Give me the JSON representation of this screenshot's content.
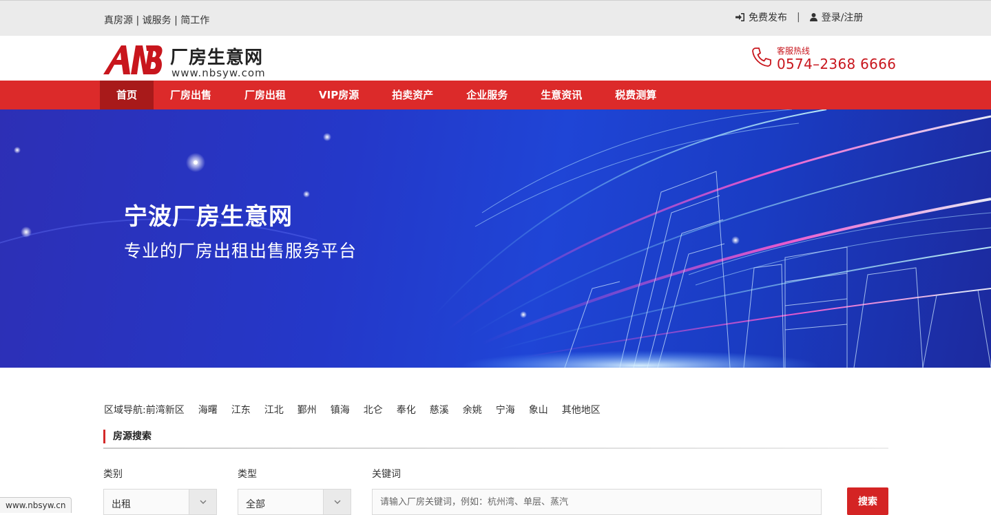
{
  "topbar": {
    "slogan": "真房源 | 诚服务 | 简工作",
    "publish": "免费发布",
    "separator": "|",
    "login": "登录/注册"
  },
  "header": {
    "logo_mark": "NB",
    "logo_name": "厂房生意网",
    "logo_url": "www.nbsyw.com",
    "hotline_label": "客服热线",
    "hotline_number": "0574–2368 6666"
  },
  "nav": {
    "items": [
      {
        "label": "首页"
      },
      {
        "label": "厂房出售"
      },
      {
        "label": "厂房出租"
      },
      {
        "label": "VIP房源"
      },
      {
        "label": "拍卖资产"
      },
      {
        "label": "企业服务"
      },
      {
        "label": "生意资讯"
      },
      {
        "label": "税费测算"
      }
    ]
  },
  "banner": {
    "title": "宁波厂房生意网",
    "subtitle": "专业的厂房出租出售服务平台"
  },
  "area_nav": {
    "lead": "区域导航:",
    "areas": [
      "前湾新区",
      "海曙",
      "江东",
      "江北",
      "鄞州",
      "镇海",
      "北仑",
      "奉化",
      "慈溪",
      "余姚",
      "宁海",
      "象山",
      "其他地区"
    ]
  },
  "search": {
    "section_title": "房源搜索",
    "category_label": "类别",
    "category_value": "出租",
    "type_label": "类型",
    "type_value": "全部",
    "keyword_label": "关键词",
    "keyword_placeholder": "请输入厂房关键词，例如：杭州湾、单层、蒸汽",
    "submit": "搜索"
  },
  "statusbar": {
    "url": "www.nbsyw.cn"
  },
  "colors": {
    "brand_red": "#dc2a2a",
    "nav_active": "#a81a1a",
    "banner_blue": "#2438c9"
  }
}
